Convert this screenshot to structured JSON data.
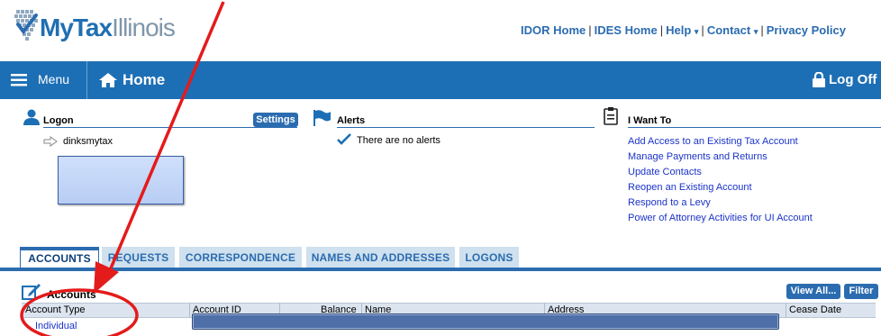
{
  "header": {
    "logo": {
      "my": "My",
      "tax": "Tax",
      "illinois": "Illinois"
    },
    "links": [
      "IDOR Home",
      "IDES Home",
      "Help",
      "Contact",
      "Privacy Policy"
    ],
    "separator": "|",
    "caret": "▾"
  },
  "navbar": {
    "menu_label": "Menu",
    "home_label": "Home",
    "logoff_label": "Log Off"
  },
  "logon": {
    "title": "Logon",
    "settings_label": "Settings",
    "username": "dinksmytax"
  },
  "alerts": {
    "title": "Alerts",
    "message": "There are no alerts"
  },
  "iwantto": {
    "title": "I Want To",
    "links": [
      "Add Access to an Existing Tax Account",
      "Manage Payments and Returns",
      "Update Contacts",
      "Reopen an Existing Account",
      "Respond to a Levy",
      "Power of Attorney Activities for UI Account"
    ]
  },
  "tabs": [
    "ACCOUNTS",
    "REQUESTS",
    "CORRESPONDENCE",
    "NAMES AND ADDRESSES",
    "LOGONS"
  ],
  "accounts": {
    "title": "Accounts",
    "view_all_label": "View All...",
    "filter_label": "Filter",
    "columns": [
      "Account Type",
      "Account ID",
      "Balance",
      "Name",
      "Address",
      "Cease Date"
    ],
    "rows": [
      {
        "account_type": "Individual"
      }
    ]
  },
  "colors": {
    "nav_blue": "#1d6fb5",
    "link_blue": "#1a33c9",
    "annotation_red": "#e41b1b"
  }
}
